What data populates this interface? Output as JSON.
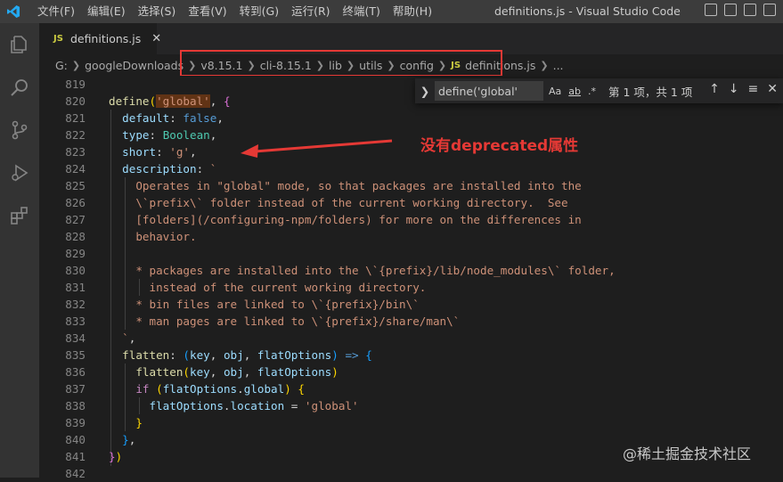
{
  "window": {
    "title": "definitions.js - Visual Studio Code",
    "menu": [
      "文件(F)",
      "编辑(E)",
      "选择(S)",
      "查看(V)",
      "转到(G)",
      "运行(R)",
      "终端(T)",
      "帮助(H)"
    ]
  },
  "tab": {
    "badge": "JS",
    "label": "definitions.js",
    "close": "✕"
  },
  "breadcrumb": {
    "items": [
      "G:",
      "googleDownloads",
      "v8.15.1",
      "cli-8.15.1",
      "lib",
      "utils",
      "config",
      "definitions.js",
      "..."
    ],
    "file_badge": "JS"
  },
  "find": {
    "query": "define('global'",
    "options": [
      "Aa",
      "ab",
      ".*"
    ],
    "count": "第 1 项，共 1 项"
  },
  "annotation": "没有deprecated属性",
  "watermark": "@稀土掘金技术社区",
  "colors": {
    "accent": "#e53935",
    "editor_bg": "#1e1e1e"
  },
  "code": {
    "line_numbers": [
      "819",
      "820",
      "821",
      "822",
      "823",
      "824",
      "825",
      "826",
      "827",
      "828",
      "829",
      "830",
      "831",
      "832",
      "833",
      "834",
      "835",
      "836",
      "837",
      "838",
      "839",
      "840",
      "841",
      "842"
    ],
    "lines": [
      "",
      "define('global', {",
      "  default: false,",
      "  type: Boolean,",
      "  short: 'g',",
      "  description: `",
      "    Operates in \"global\" mode, so that packages are installed into the",
      "    \\`prefix\\` folder instead of the current working directory.  See",
      "    [folders](/configuring-npm/folders) for more on the differences in",
      "    behavior.",
      "",
      "    * packages are installed into the \\`{prefix}/lib/node_modules\\` folder,",
      "      instead of the current working directory.",
      "    * bin files are linked to \\`{prefix}/bin\\`",
      "    * man pages are linked to \\`{prefix}/share/man\\`",
      "  `,",
      "  flatten: (key, obj, flatOptions) => {",
      "    flatten(key, obj, flatOptions)",
      "    if (flatOptions.global) {",
      "      flatOptions.location = 'global'",
      "    }",
      "  },",
      "})",
      ""
    ]
  }
}
